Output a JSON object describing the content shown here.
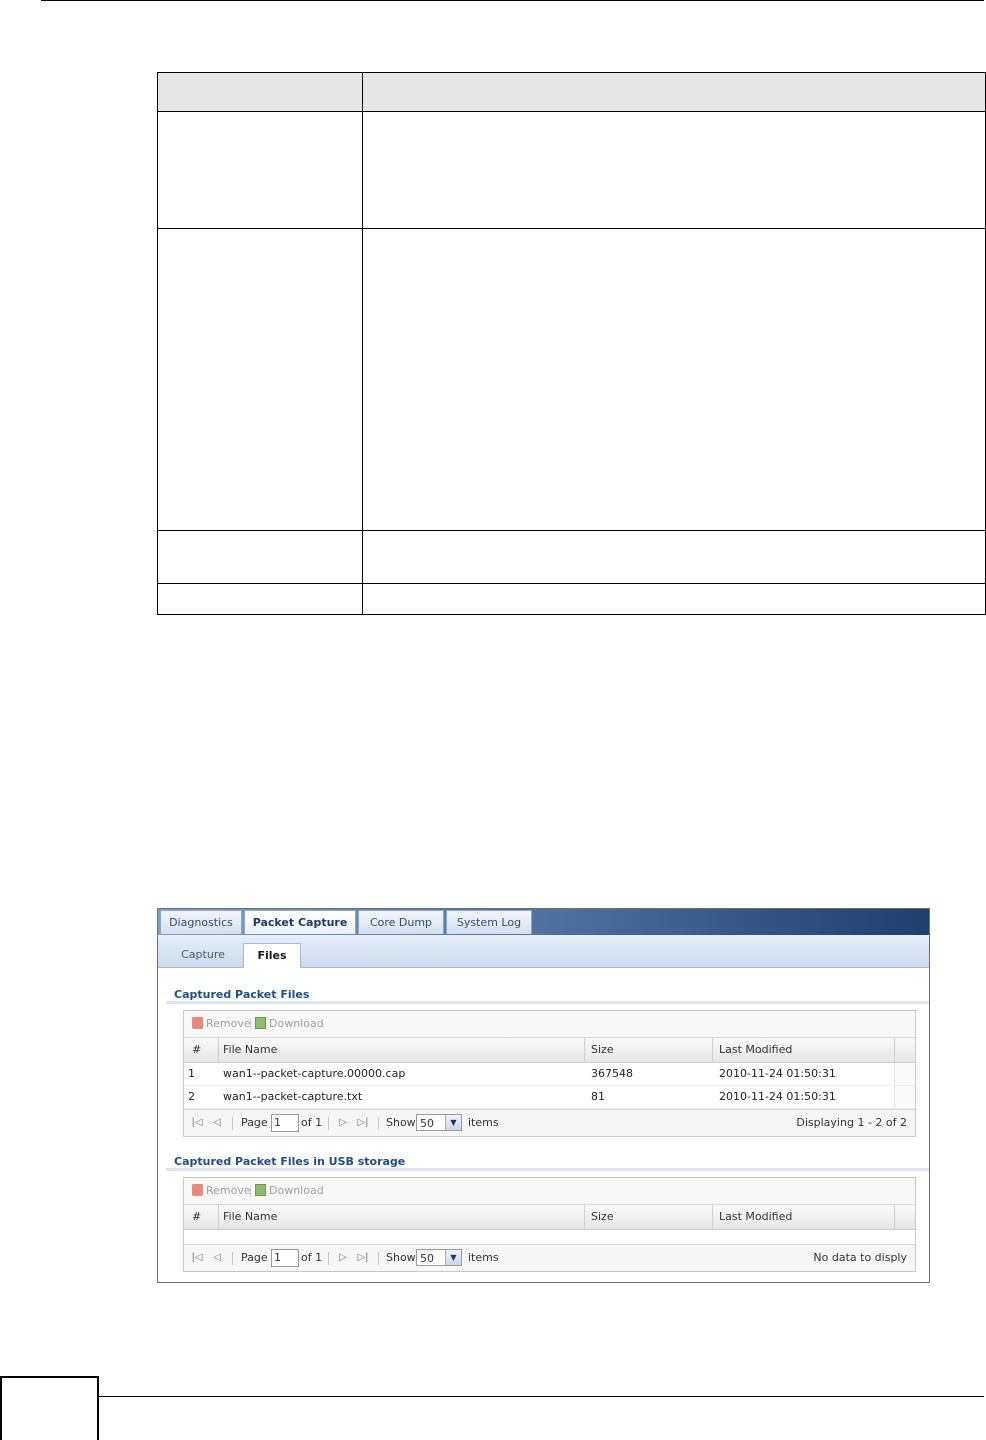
{
  "tabs": [
    {
      "label": "Diagnostics"
    },
    {
      "label": "Packet Capture"
    },
    {
      "label": "Core Dump"
    },
    {
      "label": "System Log"
    }
  ],
  "subtabs": [
    {
      "label": "Capture"
    },
    {
      "label": "Files"
    }
  ],
  "sections": [
    {
      "title": "Captured Packet Files",
      "toolbar": {
        "remove": "Remove",
        "download": "Download"
      },
      "columns": [
        "#",
        "File Name",
        "Size",
        "Last Modified"
      ],
      "rows": [
        {
          "num": "1",
          "file": "wan1--packet-capture.00000.cap",
          "size": "367548",
          "modified": "2010-11-24 01:50:31"
        },
        {
          "num": "2",
          "file": "wan1--packet-capture.txt",
          "size": "81",
          "modified": "2010-11-24 01:50:31"
        }
      ],
      "pager": {
        "page_label": "Page",
        "page_value": "1",
        "of_label": "of 1",
        "show_label": "Show",
        "show_value": "50",
        "items_label": "items",
        "status": "Displaying 1 - 2 of 2"
      }
    },
    {
      "title": "Captured Packet Files in USB storage",
      "toolbar": {
        "remove": "Remove",
        "download": "Download"
      },
      "columns": [
        "#",
        "File Name",
        "Size",
        "Last Modified"
      ],
      "rows": [],
      "pager": {
        "page_label": "Page",
        "page_value": "1",
        "of_label": "of 1",
        "show_label": "Show",
        "show_value": "50",
        "items_label": "items",
        "status": "No data to disply"
      }
    }
  ],
  "icons": {
    "remove": "trash-icon",
    "download": "disk-icon",
    "first": "first-page-icon",
    "prev": "prev-page-icon",
    "next": "next-page-icon",
    "last": "last-page-icon",
    "dropdown": "chevron-down-icon"
  },
  "colors": {
    "section_title": "#1f4e85",
    "tab_gradient_dark": "#1f3f6e"
  }
}
